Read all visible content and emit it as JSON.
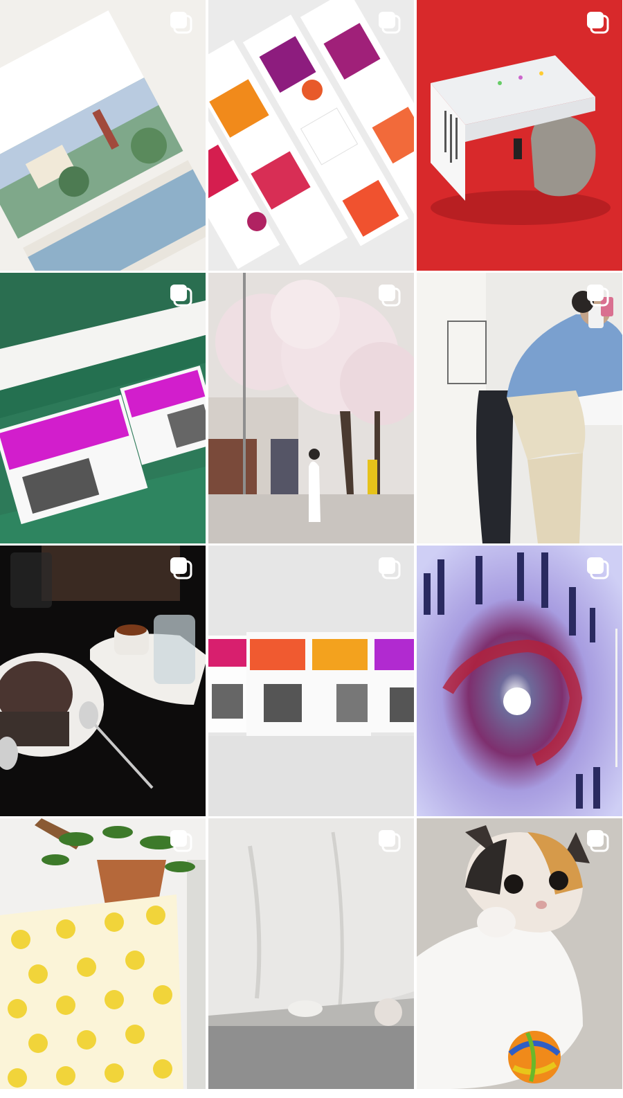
{
  "grid": {
    "posts": [
      {
        "id": "post-1",
        "kind": "book-illustration",
        "multi": true,
        "accent": "#f0eee9"
      },
      {
        "id": "post-2",
        "kind": "color-swatch-books",
        "multi": true,
        "accent": "#eceaea"
      },
      {
        "id": "post-3",
        "kind": "book-on-rock",
        "multi": true,
        "accent": "#d8292b"
      },
      {
        "id": "post-4",
        "kind": "books-on-green-shelf",
        "multi": true,
        "accent": "#2e7d5a"
      },
      {
        "id": "post-5",
        "kind": "cherry-blossom-street",
        "multi": true,
        "accent": "#d9d4d0"
      },
      {
        "id": "post-6",
        "kind": "person-selfie",
        "multi": true,
        "accent": "#e9e7e4"
      },
      {
        "id": "post-7",
        "kind": "coffee-table-dark",
        "multi": true,
        "accent": "#111111"
      },
      {
        "id": "post-8",
        "kind": "book-series-row",
        "multi": true,
        "accent": "#e6e6e6"
      },
      {
        "id": "post-9",
        "kind": "typography-spiral",
        "multi": true,
        "accent": "#9a9ae6"
      },
      {
        "id": "post-10",
        "kind": "plant-yellow-cloth",
        "multi": true,
        "accent": "#f1f1ef"
      },
      {
        "id": "post-11",
        "kind": "cat-under-sheet",
        "multi": true,
        "accent": "#dcdcda"
      },
      {
        "id": "post-12",
        "kind": "kitten-with-toy",
        "multi": true,
        "accent": "#cfcbc6"
      }
    ],
    "icon_name": "multiple-photos-icon"
  }
}
